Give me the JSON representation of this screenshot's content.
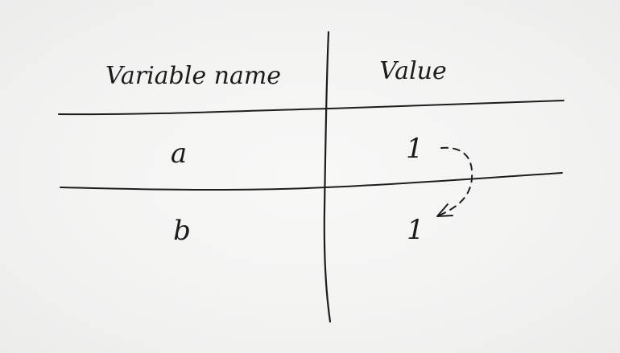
{
  "table": {
    "headers": [
      "Variable name",
      "Value"
    ],
    "rows": [
      {
        "name": "a",
        "value": "1"
      },
      {
        "name": "b",
        "value": "1"
      }
    ]
  },
  "annotation": {
    "from_row": 0,
    "to_row": 1,
    "style": "dashed-curved-arrow"
  },
  "colors": {
    "ink": "#1d1d1d",
    "paper": "#f4f4f3"
  }
}
